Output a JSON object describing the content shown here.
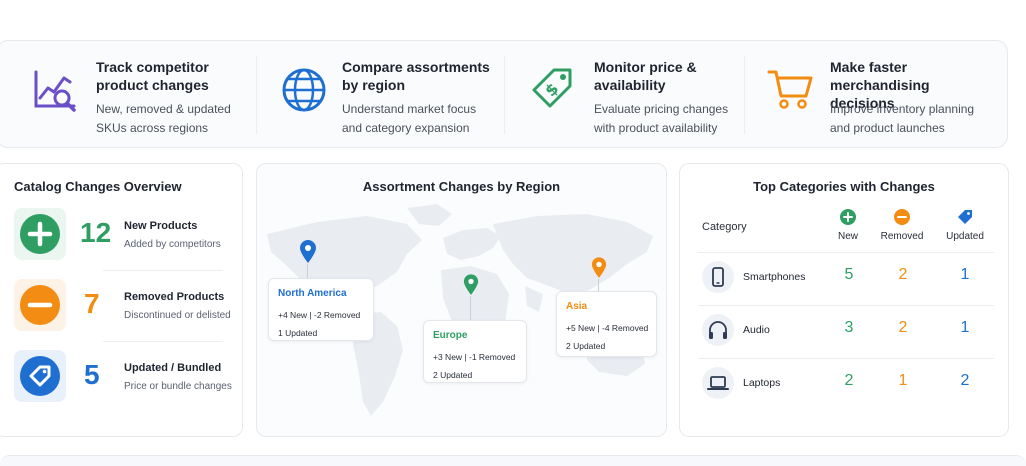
{
  "features": [
    {
      "icon": "chart-search-icon",
      "title_line1": "Track competitor",
      "title_line2": "product changes",
      "desc_line1": "New, removed & updated",
      "desc_line2": "SKUs across regions"
    },
    {
      "icon": "globe-icon",
      "title_line1": "Compare assortments",
      "title_line2": "by region",
      "desc_line1": "Understand market focus",
      "desc_line2": "and category expansion"
    },
    {
      "icon": "price-tag-icon",
      "title_line1": "Monitor price &",
      "title_line2": "availability",
      "desc_line1": "Evaluate pricing changes",
      "desc_line2": "with product availability"
    },
    {
      "icon": "shopping-cart-icon",
      "title_line1": "Make faster",
      "title_line2": "merchandising decisions",
      "desc_line1": "Improve inventory planning",
      "desc_line2": "and product launches"
    }
  ],
  "catalog": {
    "title": "Catalog Changes Overview",
    "stats": [
      {
        "icon": "plus-icon",
        "value": "12",
        "label": "New Products",
        "sub": "Added by competitors",
        "color": "#2e9e63",
        "bg": "#eaf6ef"
      },
      {
        "icon": "minus-icon",
        "value": "7",
        "label": "Removed Products",
        "sub": "Discontinued or delisted",
        "color": "#f28c12",
        "bg": "#fdf2e6"
      },
      {
        "icon": "tag-icon",
        "value": "5",
        "label": "Updated / Bundled",
        "sub": "Price or bundle changes",
        "color": "#1f6fd1",
        "bg": "#e8f0fb"
      }
    ]
  },
  "map": {
    "title": "Assortment Changes by Region",
    "regions": [
      {
        "name": "North America",
        "line1": "+4 New   |   -2 Removed",
        "line2": "1 Updated",
        "color": "#1f6fd1"
      },
      {
        "name": "Europe",
        "line1": "+3 New   |   -1 Removed",
        "line2": "2 Updated",
        "color": "#2e9e63"
      },
      {
        "name": "Asia",
        "line1": "+5 New   |   -4 Removed",
        "line2": "2 Updated",
        "color": "#f28c12"
      }
    ]
  },
  "categories": {
    "title": "Top Categories with Changes",
    "header_category": "Category",
    "header_new": "New",
    "header_removed": "Removed",
    "header_updated": "Updated",
    "rows": [
      {
        "icon": "smartphone-icon",
        "name": "Smartphones",
        "new": "5",
        "removed": "2",
        "updated": "1"
      },
      {
        "icon": "headphones-icon",
        "name": "Audio",
        "new": "3",
        "removed": "2",
        "updated": "1"
      },
      {
        "icon": "laptop-icon",
        "name": "Laptops",
        "new": "2",
        "removed": "1",
        "updated": "2"
      }
    ]
  },
  "colors": {
    "green": "#2e9e63",
    "orange": "#f28c12",
    "blue": "#1f6fd1",
    "purple": "#6b4fc8"
  }
}
